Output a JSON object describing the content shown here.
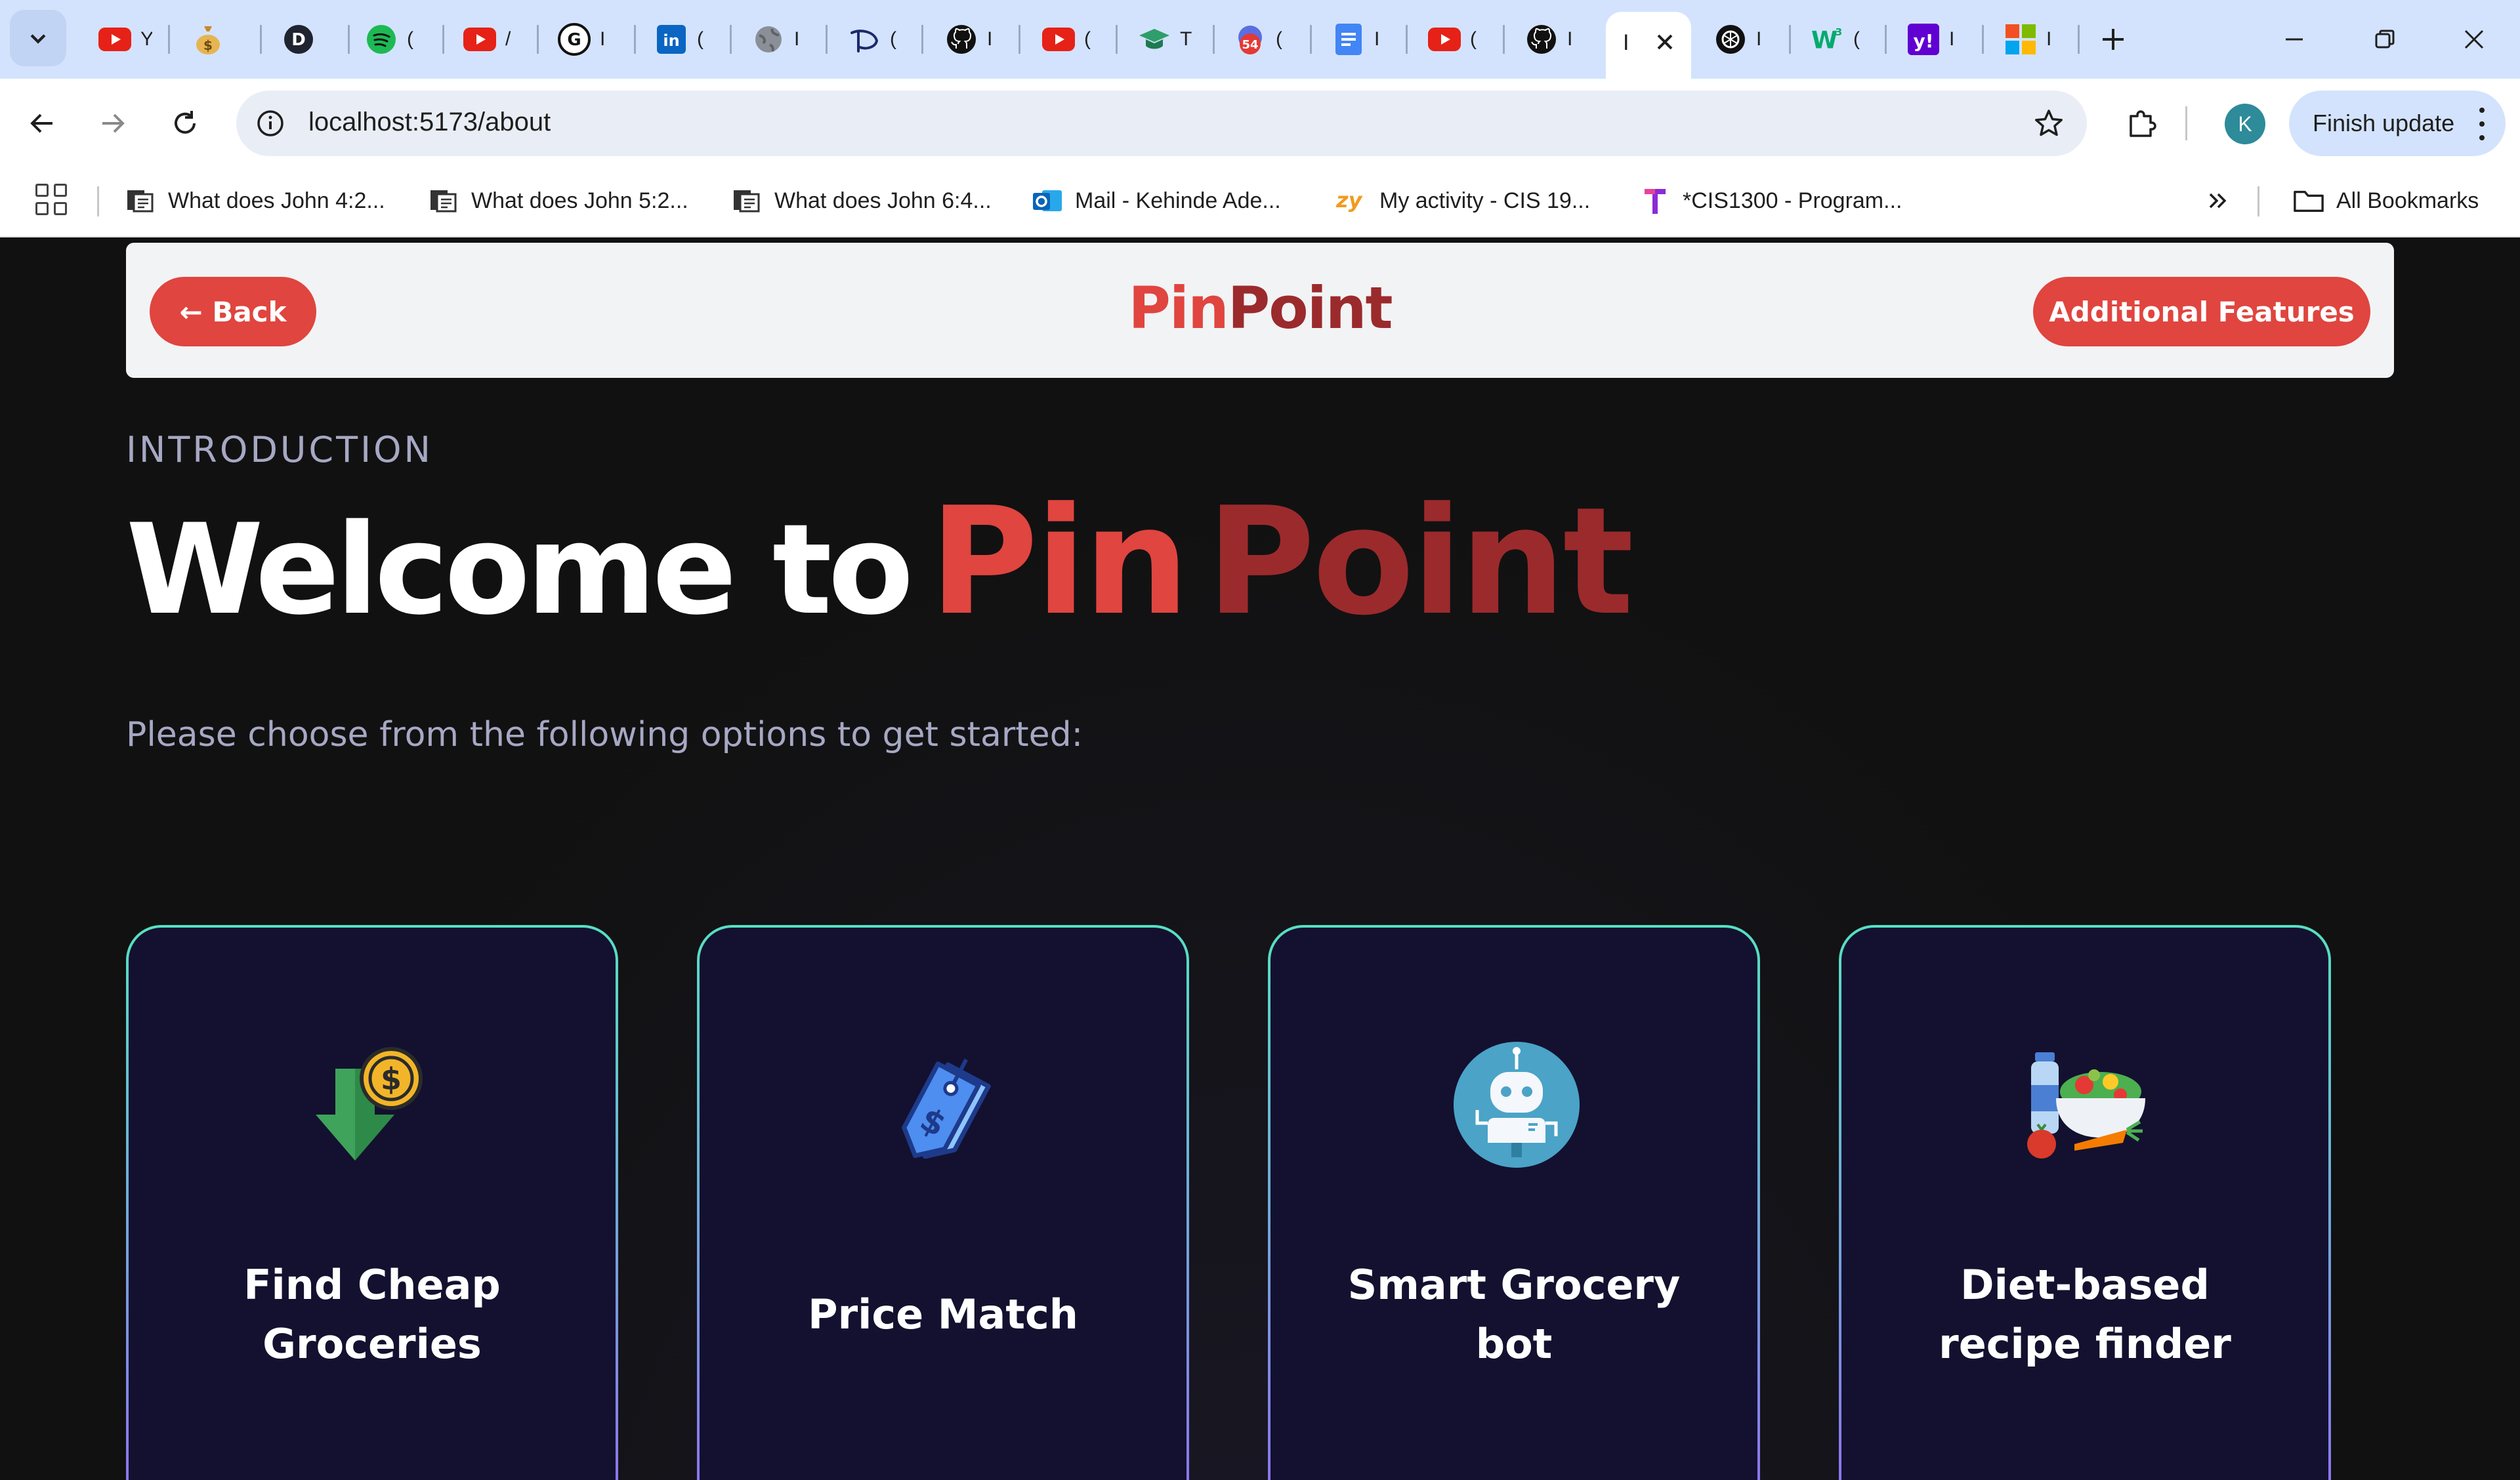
{
  "browser": {
    "tabs": [
      {
        "icon": "youtube-icon",
        "title": "Y"
      },
      {
        "icon": "money-bag-icon",
        "title": "💰"
      },
      {
        "icon": "d-logo-icon",
        "title": "D"
      },
      {
        "icon": "spotify-icon",
        "title": "("
      },
      {
        "icon": "youtube-icon",
        "title": "/"
      },
      {
        "icon": "grammarly-icon",
        "title": "I"
      },
      {
        "icon": "linkedin-icon",
        "title": "("
      },
      {
        "icon": "globe-icon",
        "title": "I"
      },
      {
        "icon": "disney-icon",
        "title": "("
      },
      {
        "icon": "github-icon",
        "title": "I"
      },
      {
        "icon": "youtube-icon",
        "title": "("
      },
      {
        "icon": "graduation-cap-icon",
        "title": "T"
      },
      {
        "icon": "notification-54-icon",
        "title": "("
      },
      {
        "icon": "docs-icon",
        "title": "I"
      },
      {
        "icon": "youtube-icon",
        "title": "("
      },
      {
        "icon": "github-icon",
        "title": "I"
      },
      {
        "icon": "openai-icon",
        "title": "I"
      },
      {
        "icon": "w3schools-icon",
        "title": "("
      },
      {
        "icon": "yahoo-icon",
        "title": "I"
      },
      {
        "icon": "microsoft-icon",
        "title": "I"
      }
    ],
    "active_tab": {
      "title": "I"
    },
    "notification_count": "54",
    "url": "localhost:5173/about",
    "profile_initial": "K",
    "finish_update_label": "Finish update",
    "bookmarks": [
      {
        "icon": "page-icon",
        "label": "What does John 4:2..."
      },
      {
        "icon": "page-icon",
        "label": "What does John 5:2..."
      },
      {
        "icon": "page-icon",
        "label": "What does John 6:4..."
      },
      {
        "icon": "outlook-icon",
        "label": "Mail - Kehinde Ade..."
      },
      {
        "icon": "zybooks-icon",
        "label": "My activity - CIS 19..."
      },
      {
        "icon": "t-logo-icon",
        "label": "*CIS1300 - Program..."
      }
    ],
    "all_bookmarks_label": "All Bookmarks"
  },
  "navbar": {
    "back_label": "← Back",
    "brand_part1": "Pin",
    "brand_part2": "Point",
    "features_label": "Additional Features"
  },
  "hero": {
    "eyebrow": "INTRODUCTION",
    "welcome": "Welcome to",
    "pin": "Pin",
    "point": "Point",
    "subtitle": "Please choose from the following options to get started:"
  },
  "cards": [
    {
      "icon": "money-down-arrow-icon",
      "title_line1": "Find Cheap",
      "title_line2": "Groceries"
    },
    {
      "icon": "price-tag-icon",
      "title": "Price Match"
    },
    {
      "icon": "robot-icon",
      "title_line1": "Smart Grocery",
      "title_line2": "bot"
    },
    {
      "icon": "healthy-food-icon",
      "title_line1": "Diet-based",
      "title_line2": "recipe finder"
    }
  ],
  "colors": {
    "accent_red": "#e0453f",
    "accent_dark_red": "#9b2a2c",
    "page_bg": "#111111",
    "card_bg": "#13112f",
    "card_border_top": "#56e0c2",
    "card_border_bottom": "#8f6ff0",
    "muted_text": "#a6a8c4"
  }
}
